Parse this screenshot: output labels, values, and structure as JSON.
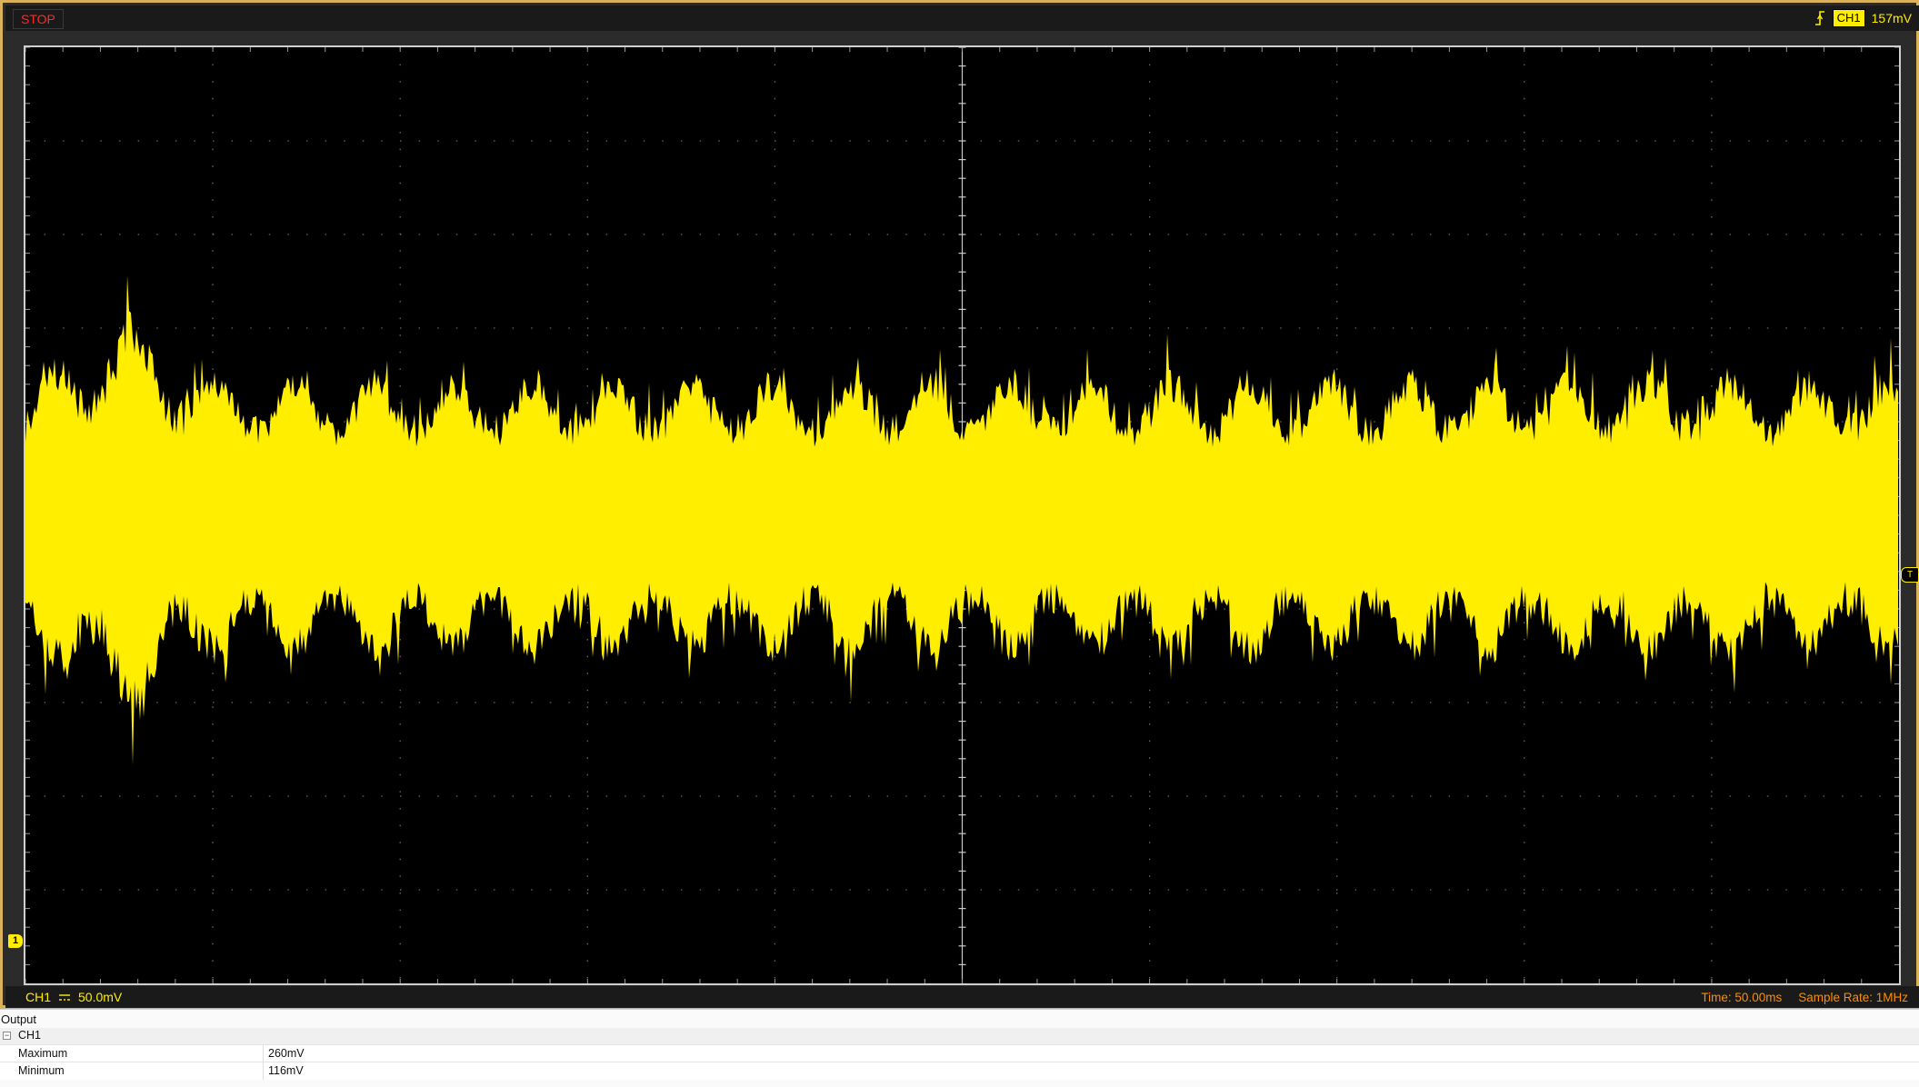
{
  "status": {
    "run_state": "STOP"
  },
  "trigger": {
    "edge_icon": "rising-edge-icon",
    "source": "CH1",
    "level": "157mV"
  },
  "channel": {
    "name": "CH1",
    "coupling_icon": "dc-coupling-icon",
    "volts_per_div": "50.0mV",
    "marker": "1",
    "trigger_marker": "T"
  },
  "timebase": {
    "time_div": "Time: 50.00ms",
    "sample_rate": "Sample Rate: 1MHz"
  },
  "colors": {
    "trace": "#ffee00",
    "screen_bg": "#000000",
    "stop": "#ff2a2a",
    "timebase_text": "#ff8c00"
  },
  "output_panel": {
    "title": "Output",
    "group": "CH1",
    "measurements": [
      {
        "name": "Maximum",
        "value": "260mV"
      },
      {
        "name": "Minimum",
        "value": "116mV"
      }
    ]
  }
}
